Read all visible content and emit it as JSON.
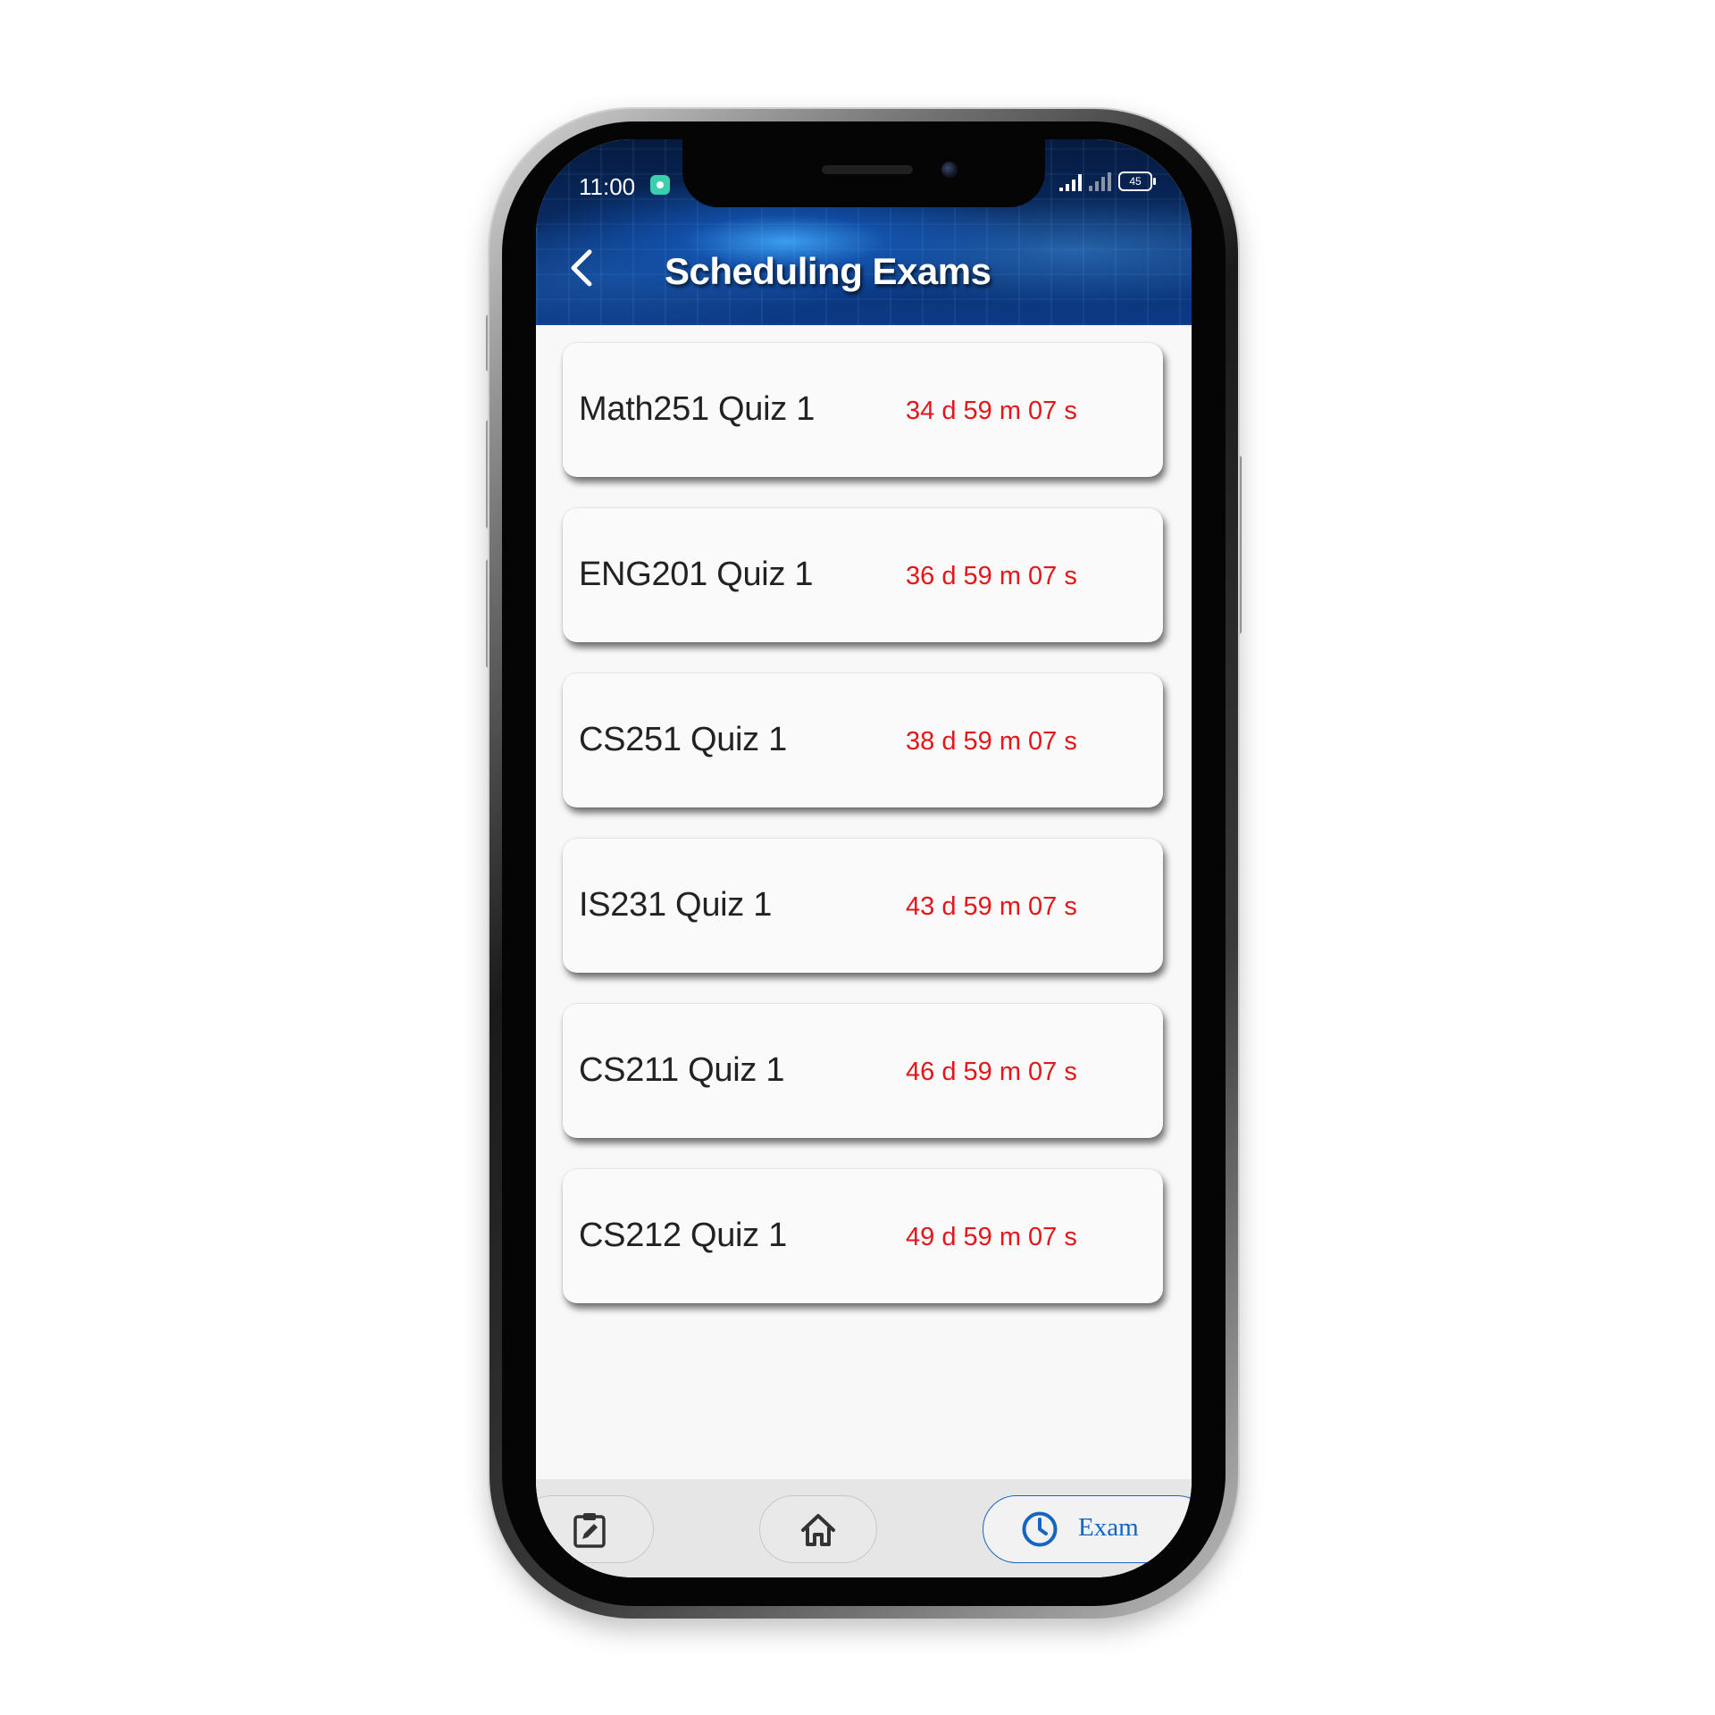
{
  "status_bar": {
    "time": "11:00",
    "battery": "45"
  },
  "header": {
    "title": "Scheduling Exams",
    "back_icon": "chevron-left-icon"
  },
  "exams": [
    {
      "name": "Math251 Quiz 1",
      "countdown": "34 d 59 m 07 s"
    },
    {
      "name": "ENG201 Quiz 1",
      "countdown": "36 d 59 m 07 s"
    },
    {
      "name": "CS251 Quiz 1",
      "countdown": "38 d 59 m 07 s"
    },
    {
      "name": "IS231 Quiz 1",
      "countdown": "43 d 59 m 07 s"
    },
    {
      "name": "CS211 Quiz 1",
      "countdown": "46 d 59 m 07 s"
    },
    {
      "name": "CS212 Quiz 1",
      "countdown": "49 d 59 m 07 s"
    }
  ],
  "bottom_nav": {
    "items": [
      {
        "icon": "clipboard-edit-icon",
        "active": false
      },
      {
        "icon": "home-icon",
        "active": false
      },
      {
        "icon": "clock-icon",
        "label": "Exam",
        "active": true
      }
    ]
  },
  "colors": {
    "countdown": "#e0171b",
    "accent": "#1565c0",
    "card_background": "#fafafa"
  }
}
